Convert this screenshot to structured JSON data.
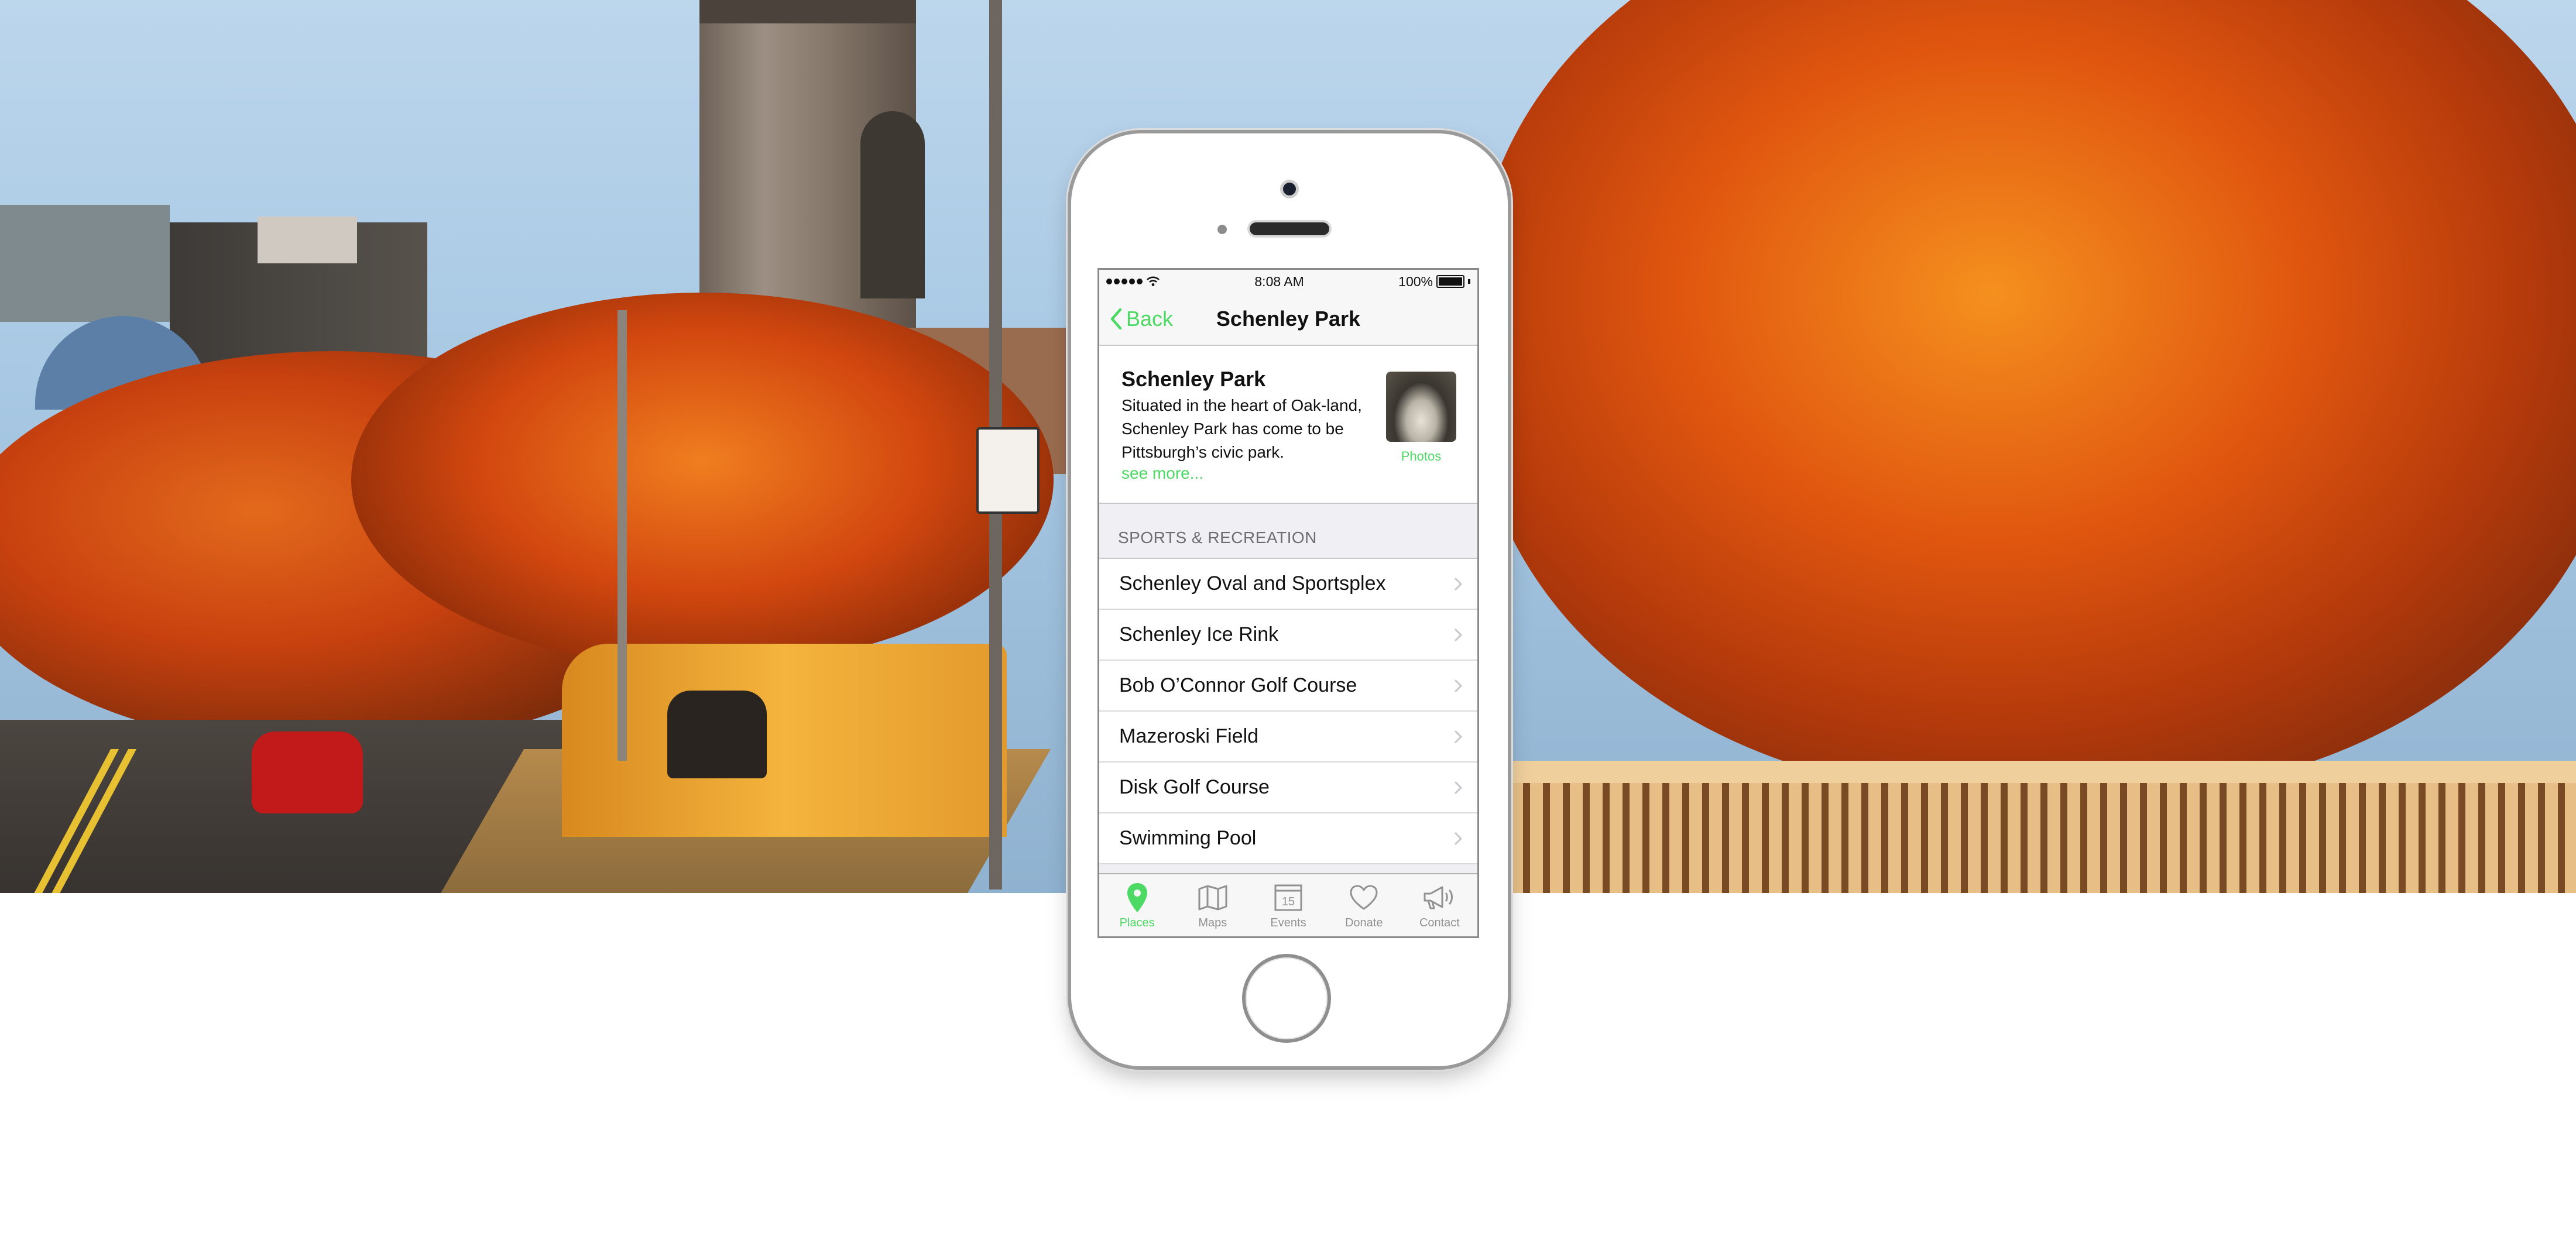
{
  "status_bar": {
    "time": "8:08 AM",
    "battery": "100%"
  },
  "nav": {
    "back_label": "Back",
    "title": "Schenley Park"
  },
  "intro": {
    "title": "Schenley Park",
    "description": "Situated in the heart of Oak-land, Schenley Park has come to be Pittsburgh’s civic park.",
    "see_more": "see more...",
    "photos_label": "Photos"
  },
  "section": {
    "header": "SPORTS & RECREATION",
    "items": [
      {
        "label": "Schenley Oval and Sportsplex"
      },
      {
        "label": "Schenley Ice Rink"
      },
      {
        "label": "Bob O’Connor Golf Course"
      },
      {
        "label": "Mazeroski Field"
      },
      {
        "label": "Disk Golf Course"
      },
      {
        "label": "Swimming Pool"
      }
    ]
  },
  "tabs": [
    {
      "label": "Places",
      "icon": "map-pin-icon",
      "active": true
    },
    {
      "label": "Maps",
      "icon": "folded-map-icon",
      "active": false
    },
    {
      "label": "Events",
      "icon": "calendar-icon",
      "calendar_day": "15",
      "active": false
    },
    {
      "label": "Donate",
      "icon": "heart-icon",
      "active": false
    },
    {
      "label": "Contact",
      "icon": "megaphone-icon",
      "active": false
    }
  ],
  "colors": {
    "accent": "#4cd964",
    "inactive_tab": "#929292",
    "group_background": "#efeff4"
  }
}
